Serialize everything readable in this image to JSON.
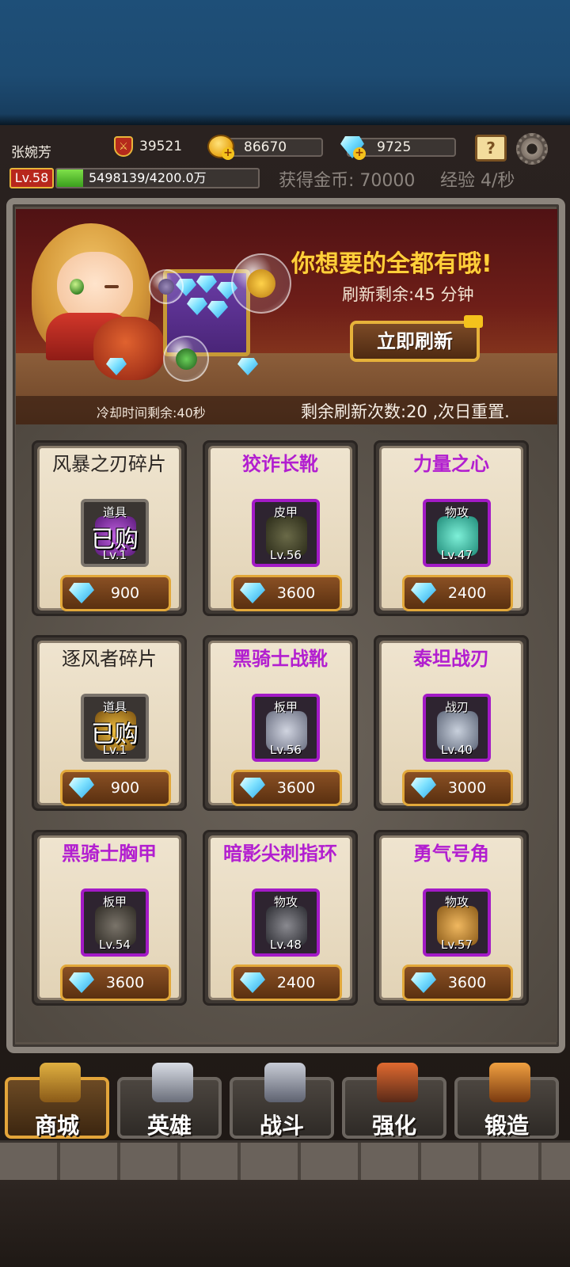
{
  "player": {
    "name": "张婉芳",
    "combat_power": "39521",
    "gold": "86670",
    "diamonds": "9725",
    "level": "Lv.58",
    "exp_text": "5498139/4200.0万",
    "exp_fraction": 0.13
  },
  "gains": {
    "gold_label": "获得金币: 70000",
    "exp_label": "经验 4/秒"
  },
  "shop": {
    "slogan": "你想要的全都有哦!",
    "refresh_remaining": "刷新剩余:45 分钟",
    "refresh_button": "立即刷新",
    "cooldown": "冷却时间剩余:40秒",
    "refresh_count": "剩余刷新次数:20 ,次日重置.",
    "items": [
      {
        "name": "风暴之刃碎片",
        "type": "道具",
        "level": "Lv.1",
        "price": "900",
        "sold": "已购",
        "rarity": "normal"
      },
      {
        "name": "狡诈长靴",
        "type": "皮甲",
        "level": "Lv.56",
        "price": "3600",
        "sold": "",
        "rarity": "epic"
      },
      {
        "name": "力量之心",
        "type": "物攻",
        "level": "Lv.47",
        "price": "2400",
        "sold": "",
        "rarity": "epic"
      },
      {
        "name": "逐风者碎片",
        "type": "道具",
        "level": "Lv.1",
        "price": "900",
        "sold": "已购",
        "rarity": "normal"
      },
      {
        "name": "黑骑士战靴",
        "type": "板甲",
        "level": "Lv.56",
        "price": "3600",
        "sold": "",
        "rarity": "epic"
      },
      {
        "name": "泰坦战刃",
        "type": "战刃",
        "level": "Lv.40",
        "price": "3000",
        "sold": "",
        "rarity": "epic"
      },
      {
        "name": "黑骑士胸甲",
        "type": "板甲",
        "level": "Lv.54",
        "price": "3600",
        "sold": "",
        "rarity": "epic"
      },
      {
        "name": "暗影尖刺指环",
        "type": "物攻",
        "level": "Lv.48",
        "price": "2400",
        "sold": "",
        "rarity": "epic"
      },
      {
        "name": "勇气号角",
        "type": "物攻",
        "level": "Lv.57",
        "price": "3600",
        "sold": "",
        "rarity": "epic"
      }
    ]
  },
  "nav": [
    {
      "label": "商城",
      "icon": "treasure-chest-icon",
      "active": true
    },
    {
      "label": "英雄",
      "icon": "horned-helmet-icon",
      "active": false
    },
    {
      "label": "战斗",
      "icon": "crossed-swords-icon",
      "active": false
    },
    {
      "label": "强化",
      "icon": "hammer-anvil-icon",
      "active": false
    },
    {
      "label": "锻造",
      "icon": "forge-icon",
      "active": false
    }
  ],
  "colors": {
    "epic_title": "#b21ed0",
    "accent_gold": "#e3a53a",
    "exp_green": "#5cc22f",
    "level_red": "#b8271c"
  }
}
